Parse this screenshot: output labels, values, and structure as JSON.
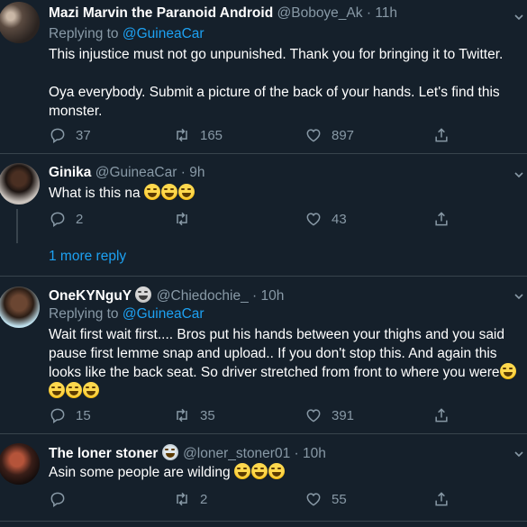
{
  "colors": {
    "background": "#15202b",
    "text": "#ffffff",
    "secondary": "#8899a6",
    "link": "#1da1f2",
    "divider": "#38444d"
  },
  "tweets": [
    {
      "name": "Mazi Marvin the Paranoid Android",
      "handle": "@Boboye_Ak",
      "time": "11h",
      "reply_prefix": "Replying to",
      "reply_to": "@GuineaCar",
      "text": "This injustice must not go unpunished. Thank you for bringing it to Twitter.\n\nOya everybody. Submit a picture of the back of your hands. Let's find this monster.",
      "replies": "37",
      "retweets": "165",
      "likes": "897"
    },
    {
      "name": "Ginika",
      "handle": "@GuineaCar",
      "time": "9h",
      "text": "What is this na",
      "replies": "2",
      "retweets": "",
      "likes": "43"
    },
    {
      "name": "OneKYNguY",
      "handle": "@Chiedochie_",
      "time": "10h",
      "reply_prefix": "Replying to",
      "reply_to": "@GuineaCar",
      "text": "Wait first wait first.... Bros put his hands between your thighs and you said pause first lemme snap and upload.. If you don't stop this. And again this looks like the back seat. So driver stretched from front to where you were",
      "replies": "15",
      "retweets": "35",
      "likes": "391"
    },
    {
      "name": "The loner stoner",
      "handle": "@loner_stoner01",
      "time": "10h",
      "text": "Asin some people are wilding",
      "replies": "",
      "retweets": "2",
      "likes": "55"
    }
  ],
  "more_replies": "1 more reply",
  "separator": "·",
  "icons": [
    "reply-icon",
    "retweet-icon",
    "like-icon",
    "share-icon",
    "chevron-down-icon"
  ]
}
